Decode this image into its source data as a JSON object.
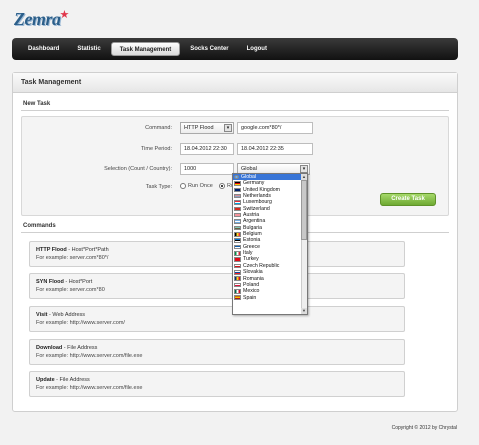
{
  "brand": {
    "name": "Zemra"
  },
  "nav": [
    "Dashboard",
    "Statistic",
    "Task Management",
    "Socks Center",
    "Logout"
  ],
  "panel_title": "Task Management",
  "new_task": {
    "title": "New Task",
    "command_label": "Command:",
    "command_value": "HTTP Flood",
    "target_value": "google.com*80*/",
    "time_label": "Time Period:",
    "time_start": "18.04.2012 22:30",
    "time_end": "18.04.2012 22:35",
    "selection_label": "Selection (Count / Country):",
    "count_value": "1000",
    "country_value": "Global",
    "tasktype_label": "Task Type:",
    "run_once": "Run Once",
    "run_partial": "Ru",
    "create_button": "Create Task"
  },
  "commands": {
    "title": "Commands",
    "items": [
      {
        "name": "HTTP Flood",
        "desc": " - Host*Port*Path",
        "example": "For example: server.com*80*/"
      },
      {
        "name": "SYN Flood",
        "desc": " - Host*Port",
        "example": "For example: server.com*80"
      },
      {
        "name": "Visit",
        "desc": " - Web Address",
        "example": "For example: http://www.server.com/"
      },
      {
        "name": "Download",
        "desc": " - File Address",
        "example": "For example: http://www.server.com/file.exe"
      },
      {
        "name": "Update",
        "desc": " - File Address",
        "example": "For example: http://www.server.com/file.exe"
      }
    ]
  },
  "countries": [
    {
      "name": "Global",
      "flag": "globe-icon"
    },
    {
      "name": "Germany",
      "flag": "germany-flag-icon"
    },
    {
      "name": "United Kingdom",
      "flag": "uk-flag-icon"
    },
    {
      "name": "Netherlands",
      "flag": "netherlands-flag-icon"
    },
    {
      "name": "Luxembourg",
      "flag": "luxembourg-flag-icon"
    },
    {
      "name": "Switzerland",
      "flag": "switzerland-flag-icon"
    },
    {
      "name": "Austria",
      "flag": "austria-flag-icon"
    },
    {
      "name": "Argentina",
      "flag": "argentina-flag-icon"
    },
    {
      "name": "Bulgaria",
      "flag": "bulgaria-flag-icon"
    },
    {
      "name": "Belgium",
      "flag": "belgium-flag-icon"
    },
    {
      "name": "Estonia",
      "flag": "estonia-flag-icon"
    },
    {
      "name": "Greece",
      "flag": "greece-flag-icon"
    },
    {
      "name": "Italy",
      "flag": "italy-flag-icon"
    },
    {
      "name": "Turkey",
      "flag": "turkey-flag-icon"
    },
    {
      "name": "Czech Republic",
      "flag": "czech-flag-icon"
    },
    {
      "name": "Slovakia",
      "flag": "slovakia-flag-icon"
    },
    {
      "name": "Romania",
      "flag": "romania-flag-icon"
    },
    {
      "name": "Poland",
      "flag": "poland-flag-icon"
    },
    {
      "name": "Mexico",
      "flag": "mexico-flag-icon"
    },
    {
      "name": "Spain",
      "flag": "spain-flag-icon"
    }
  ],
  "copyright": "Copyright © 2012 by Chrystal"
}
